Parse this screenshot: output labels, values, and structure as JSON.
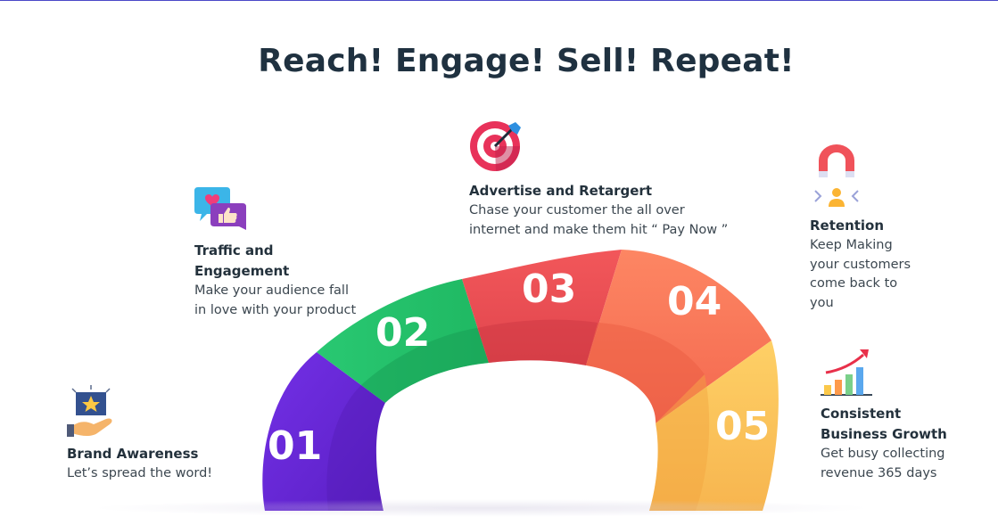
{
  "title": "Reach! Engage! Sell! Repeat!",
  "colors": {
    "stage1": "#6226d8",
    "stage2": "#25c26b",
    "stage3": "#ee4f54",
    "stage4": "#fb7a58",
    "stage5": "#fdc85c",
    "title": "#1f3140"
  },
  "steps": [
    {
      "number": "01",
      "heading": "Brand Awareness",
      "desc": [
        "Let’s spread the word!"
      ],
      "icon": "hand-star-icon"
    },
    {
      "number": "02",
      "heading": [
        "Traffic and",
        "Engagement"
      ],
      "desc": [
        "Make your audience fall",
        "in love with your product"
      ],
      "icon": "chat-like-icon"
    },
    {
      "number": "03",
      "heading": "Advertise and Retargert",
      "desc": [
        "Chase your customer the all over",
        "internet and make them hit “ Pay Now ”"
      ],
      "icon": "target-dart-icon"
    },
    {
      "number": "04",
      "heading": "Retention",
      "desc": [
        "Keep Making",
        "your customers",
        "come back to",
        "you"
      ],
      "icon": "magnet-user-icon"
    },
    {
      "number": "05",
      "heading": [
        "Consistent",
        "Business Growth"
      ],
      "desc": [
        "Get busy collecting",
        "revenue 365 days"
      ],
      "icon": "growth-chart-icon"
    }
  ]
}
